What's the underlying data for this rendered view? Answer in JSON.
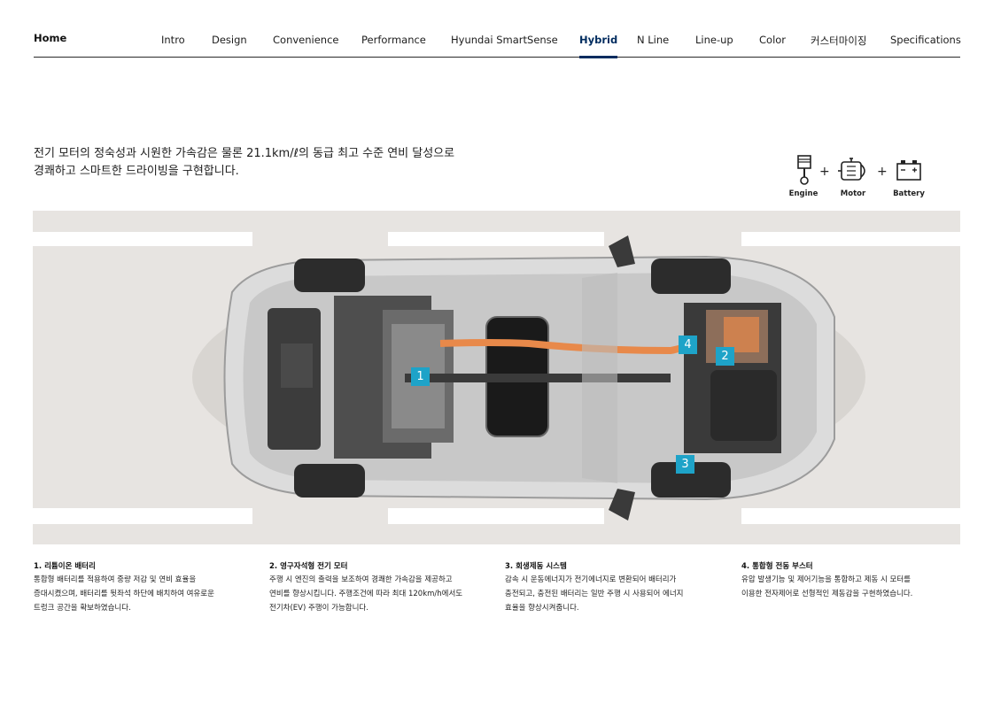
{
  "nav": {
    "home": "Home",
    "tabs": [
      {
        "label": "Intro"
      },
      {
        "label": "Design"
      },
      {
        "label": "Convenience"
      },
      {
        "label": "Performance"
      },
      {
        "label": "Hyundai SmartSense"
      },
      {
        "label": "Hybrid",
        "active": true
      },
      {
        "label": "N Line"
      },
      {
        "label": "Line-up"
      },
      {
        "label": "Color"
      },
      {
        "label": "커스터마이징"
      },
      {
        "label": "Specifications"
      }
    ]
  },
  "intro": {
    "line1": "전기 모터의 정숙성과 시원한 가속감은 물론 21.1km/ℓ의 동급 최고 수준 연비 달성으로",
    "line2": "경쾌하고 스마트한 드라이빙을 구현합니다."
  },
  "powertrain": {
    "engine": "Engine",
    "motor": "Motor",
    "battery": "Battery",
    "plus": "+"
  },
  "hotspots": [
    "1",
    "2",
    "3",
    "4"
  ],
  "features": [
    {
      "title": "1. 리튬이온 배터리",
      "lines": [
        "통합형 배터리를 적용하여 중량 저감 및 연비 효율을",
        "증대시켰으며, 배터리를 뒷좌석 하단에 배치하여 여유로운",
        "트렁크 공간을 확보하였습니다."
      ]
    },
    {
      "title": "2. 영구자석형 전기 모터",
      "lines": [
        "주행 시 엔진의 출력을 보조하여 경쾌한 가속감을 제공하고",
        "연비를 향상시킵니다. 주행조건에 따라 최대 120km/h에서도",
        "전기차(EV) 주행이 가능합니다."
      ]
    },
    {
      "title": "3. 회생제동 시스템",
      "lines": [
        "감속 시 운동에너지가 전기에너지로 변환되어 배터리가",
        "충전되고, 충전된 배터리는 일반 주행 시 사용되어 에너지",
        "효율을 향상시켜줍니다."
      ]
    },
    {
      "title": "4. 통합형 전동 부스터",
      "lines": [
        "유압 발생기능 및 제어기능을 통합하고 제동 시 모터를",
        "이용한 전자제어로 선형적인 제동감을 구현하였습니다."
      ]
    }
  ],
  "colors": {
    "accent": "#002c5f",
    "hotspot": "#1ea3c8",
    "orange_cable": "#e8894a"
  }
}
